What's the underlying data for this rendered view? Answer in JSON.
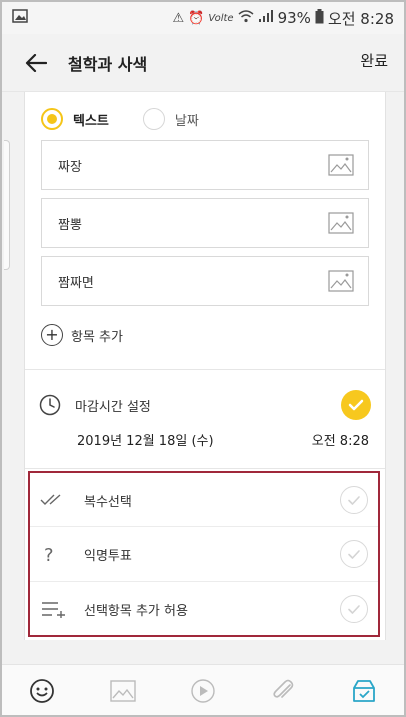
{
  "status_bar": {
    "battery": "93%",
    "time": "오전 8:28",
    "network_label": "Volte"
  },
  "header": {
    "title": "철학과 사색",
    "done_label": "완료"
  },
  "poll": {
    "type_options": [
      {
        "label": "텍스트",
        "selected": true
      },
      {
        "label": "날짜",
        "selected": false
      }
    ],
    "options": [
      "짜장",
      "짬뽕",
      "짬짜면"
    ],
    "add_item_label": "항목 추가"
  },
  "deadline": {
    "label": "마감시간 설정",
    "enabled": true,
    "date": "2019년 12월 18일 (수)",
    "time": "오전 8:28"
  },
  "settings": [
    {
      "label": "복수선택",
      "icon": "double-check-icon",
      "checked": false
    },
    {
      "label": "익명투표",
      "icon": "question-icon",
      "checked": false
    },
    {
      "label": "선택항목 추가 허용",
      "icon": "list-add-icon",
      "checked": false
    }
  ],
  "colors": {
    "accent_yellow": "#f7c81e",
    "highlight_border": "#a0283a",
    "poll_tool_blue": "#2aa6c8"
  },
  "toolbar": {
    "tools": [
      "emoji-icon",
      "image-icon",
      "play-icon",
      "attach-icon",
      "poll-box-icon"
    ]
  }
}
